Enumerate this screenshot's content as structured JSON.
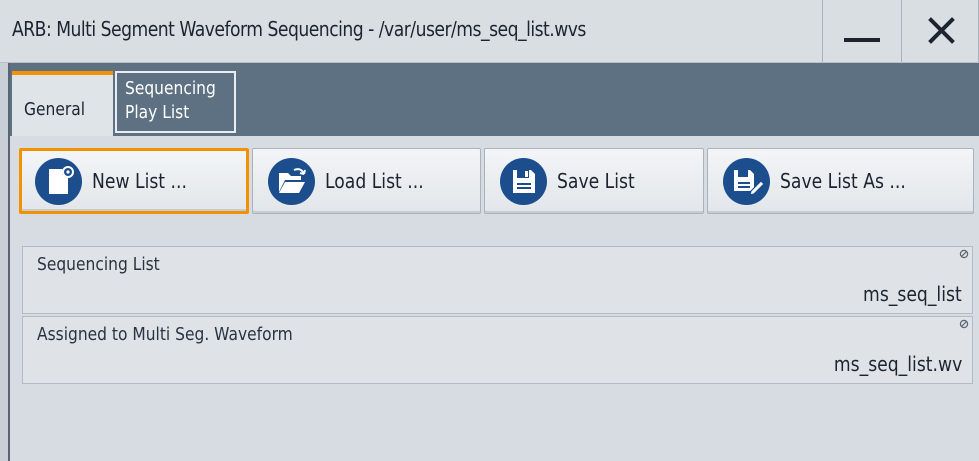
{
  "window": {
    "title": "ARB: Multi Segment Waveform Sequencing - /var/user/ms_seq_list.wvs",
    "minimize_icon": "minimize-icon",
    "close_icon": "close-icon"
  },
  "tabs": [
    {
      "label": "General",
      "active": true
    },
    {
      "label": "Sequencing\nPlay List",
      "active": false
    }
  ],
  "toolbar": {
    "buttons": [
      {
        "label": "New List ...",
        "icon": "new-file-icon",
        "focused": true
      },
      {
        "label": "Load List ...",
        "icon": "open-folder-icon",
        "focused": false
      },
      {
        "label": "Save List",
        "icon": "save-icon",
        "focused": false
      },
      {
        "label": "Save List As ...",
        "icon": "save-as-icon",
        "focused": false
      }
    ]
  },
  "fields": [
    {
      "label": "Sequencing List",
      "value": "ms_seq_list",
      "icon": "read-only-icon"
    },
    {
      "label": "Assigned to Multi Seg. Waveform",
      "value": "ms_seq_list.wv",
      "icon": "read-only-icon"
    }
  ],
  "colors": {
    "accent": "#f39200",
    "icon_circle": "#1c4d8d",
    "tabstrip": "#5d7182"
  }
}
